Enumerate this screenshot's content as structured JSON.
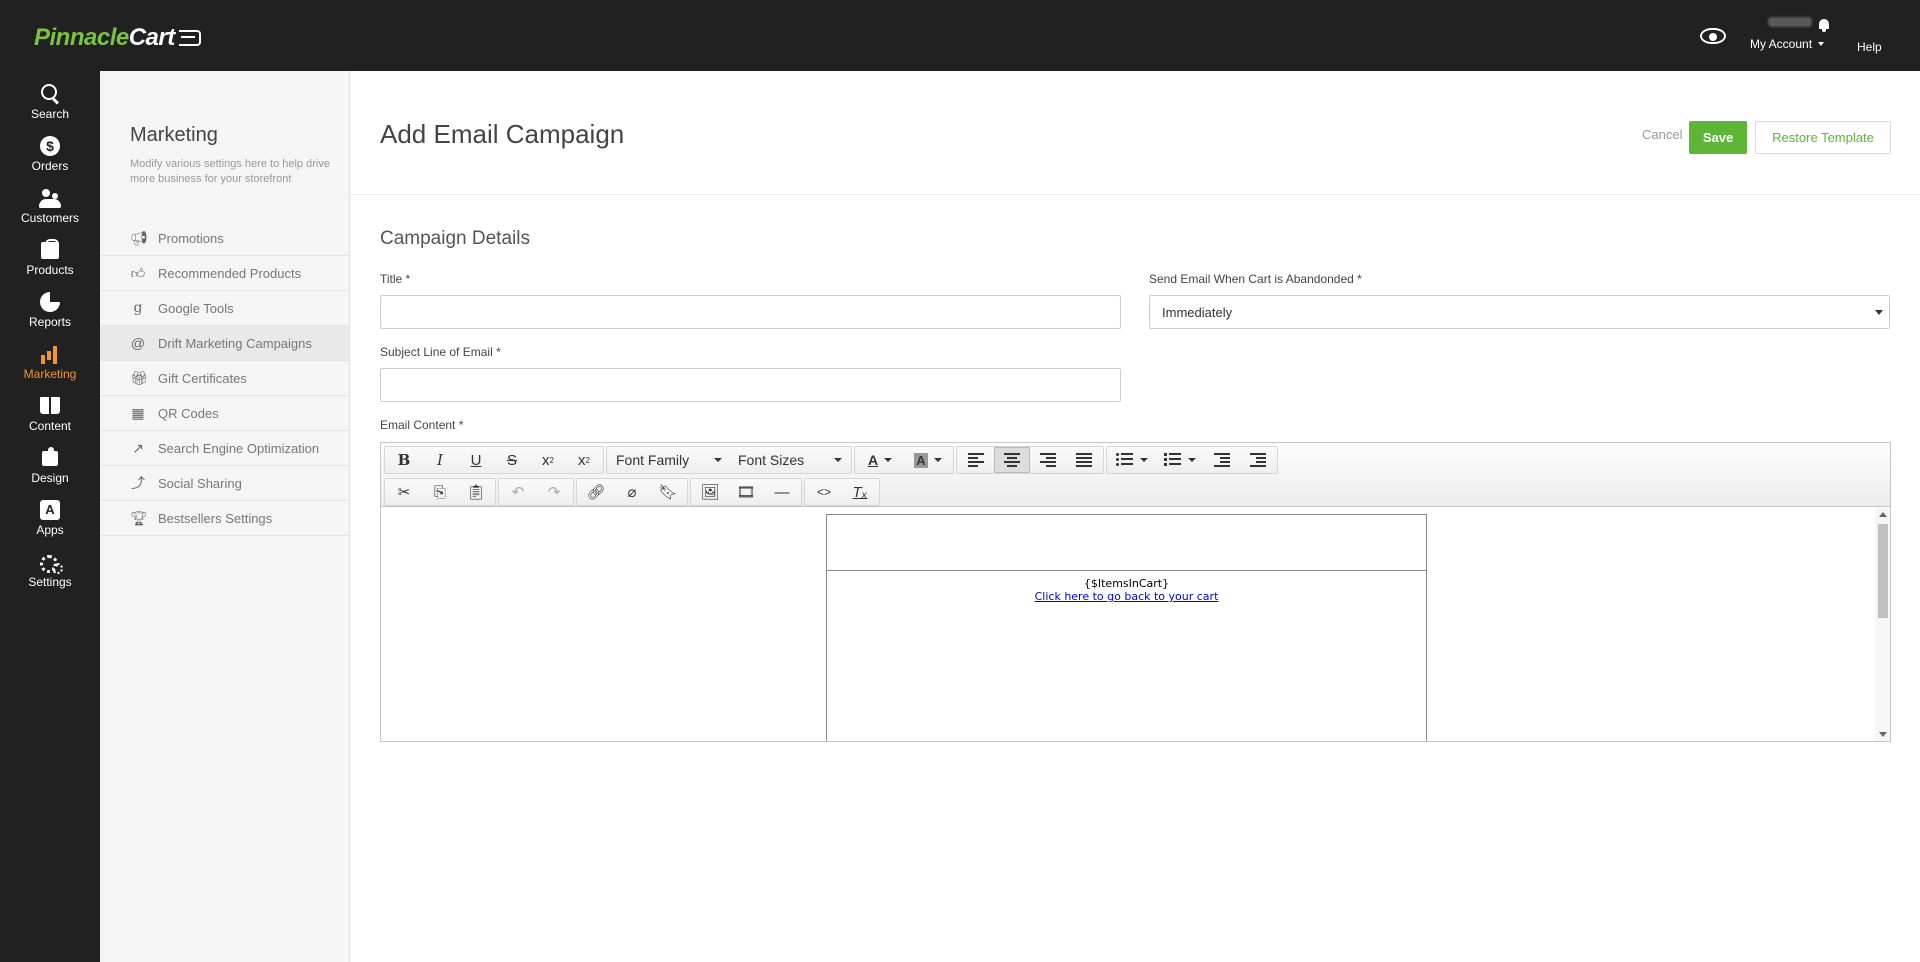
{
  "app": {
    "logo_part1": "Pinnacle",
    "logo_part2": "Cart",
    "brand_color": "#7cc242",
    "accent_color": "#f0962a"
  },
  "header": {
    "my_account": "My Account",
    "help": "Help"
  },
  "leftnav": [
    {
      "label": "Search",
      "icon": "search-icon"
    },
    {
      "label": "Orders",
      "icon": "dollar-icon"
    },
    {
      "label": "Customers",
      "icon": "users-icon"
    },
    {
      "label": "Products",
      "icon": "bag-icon"
    },
    {
      "label": "Reports",
      "icon": "pie-chart-icon"
    },
    {
      "label": "Marketing",
      "icon": "bar-chart-icon",
      "active": true
    },
    {
      "label": "Content",
      "icon": "book-icon"
    },
    {
      "label": "Design",
      "icon": "paint-bucket-icon"
    },
    {
      "label": "Apps",
      "icon": "apps-icon"
    },
    {
      "label": "Settings",
      "icon": "gears-icon"
    }
  ],
  "subnav": {
    "title": "Marketing",
    "description": "Modify various settings here to help drive more business for your storefront",
    "items": [
      {
        "label": "Promotions",
        "icon": "megaphone-icon"
      },
      {
        "label": "Recommended Products",
        "icon": "thumbs-up-icon"
      },
      {
        "label": "Google Tools",
        "icon": "google-icon"
      },
      {
        "label": "Drift Marketing Campaigns",
        "icon": "at-sign-icon",
        "active": true
      },
      {
        "label": "Gift Certificates",
        "icon": "gift-icon"
      },
      {
        "label": "QR Codes",
        "icon": "qr-code-icon"
      },
      {
        "label": "Search Engine Optimization",
        "icon": "trend-line-icon"
      },
      {
        "label": "Social Sharing",
        "icon": "share-icon"
      },
      {
        "label": "Bestsellers Settings",
        "icon": "trophy-icon"
      }
    ]
  },
  "page": {
    "title": "Add Email Campaign",
    "cancel": "Cancel",
    "save": "Save",
    "restore": "Restore Template",
    "save_color": "#5fb537"
  },
  "form": {
    "section_title": "Campaign Details",
    "title_label": "Title *",
    "title_value": "",
    "send_label": "Send Email When Cart is Abandonded *",
    "send_value": "Immediately",
    "subject_label": "Subject Line of Email *",
    "subject_value": "",
    "content_label": "Email Content *"
  },
  "editor": {
    "font_family": "Font Family",
    "font_sizes": "Font Sizes",
    "bold": "B",
    "italic": "I",
    "underline": "U",
    "strike": "S",
    "superscript": "x",
    "subscript": "x",
    "sup_mark": "2",
    "text_color": "A",
    "bg_color": "A",
    "body_placeholder": "{$ItemsInCart}",
    "body_link": "Click here to go back to your cart"
  }
}
